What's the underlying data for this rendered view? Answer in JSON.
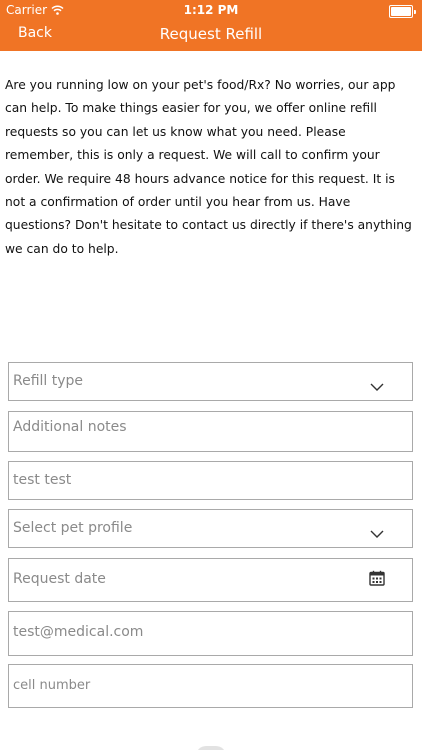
{
  "status_bar": {
    "carrier": "Carrier",
    "time": "1:12 PM"
  },
  "nav": {
    "back_label": "Back",
    "title": "Request Refill"
  },
  "intro_text": "Are you running low on your pet's food/Rx? No worries, our app can help. To make things easier for you, we offer online refill requests so you can let us know what you need. Please remember, this is only a request. We will call to confirm your order. We require 48 hours advance notice for this request. It is not a confirmation of order until you hear from us. Have questions? Don't hesitate to contact us directly if there's anything we can do to help.",
  "form": {
    "refill_type_placeholder": "Refill type",
    "notes_placeholder": "Additional notes",
    "name_value": "test test",
    "pet_profile_placeholder": "Select pet profile",
    "request_date_placeholder": "Request date",
    "email_value": "test@medical.com",
    "cell_placeholder": "cell number"
  },
  "colors": {
    "header": "#f07425",
    "border": "#a9a9a9",
    "placeholder": "#8a8a8a"
  },
  "icons": [
    "wifi-icon",
    "battery-icon",
    "chevron-down-icon",
    "calendar-icon"
  ]
}
